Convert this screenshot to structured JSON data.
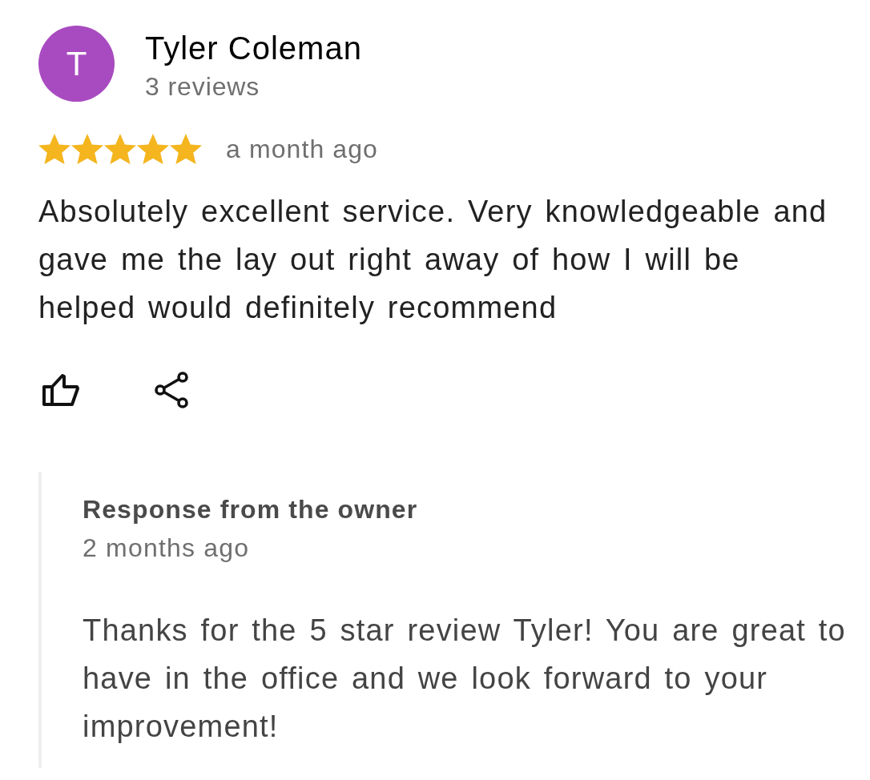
{
  "review": {
    "author": {
      "initial": "T",
      "name": "Tyler Coleman",
      "review_count": "3 reviews"
    },
    "stars": 5,
    "time": "a month ago",
    "text": "Absolutely excellent service. Very knowledgeable and gave me the lay out right away of how I will be helped would definitely recommend"
  },
  "owner_response": {
    "title": "Response from the owner",
    "time": "2 months ago",
    "text": "Thanks for the 5 star review Tyler! You are great to have in the office and we look forward to your improvement!"
  }
}
